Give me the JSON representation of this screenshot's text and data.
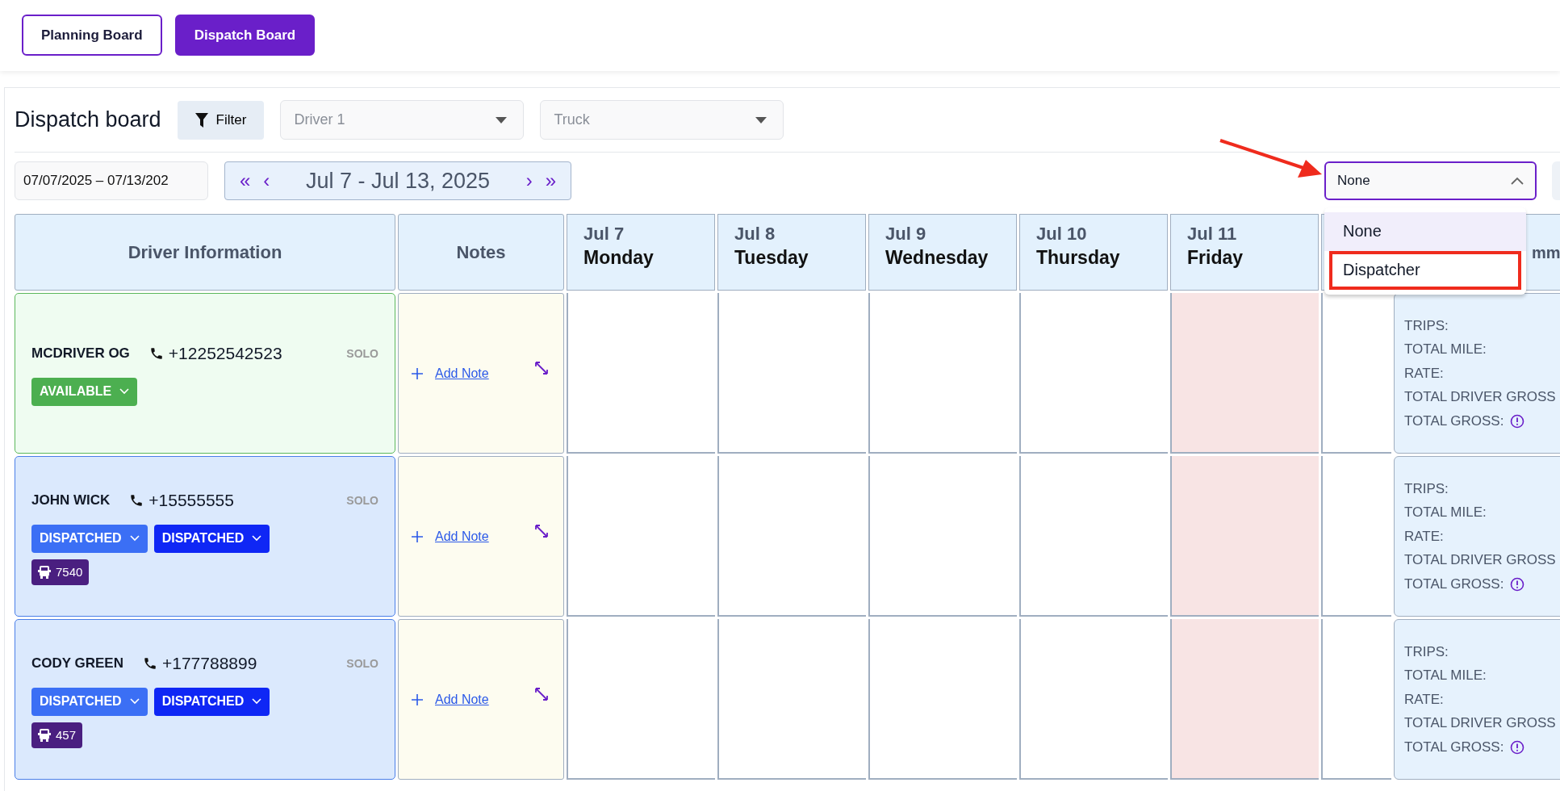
{
  "top_tabs": [
    {
      "label": "Planning Board",
      "selected": false
    },
    {
      "label": "Dispatch Board",
      "selected": true
    }
  ],
  "title": "Dispatch board",
  "filter_button": "Filter",
  "driver_select": {
    "placeholder": "Driver 1"
  },
  "truck_select": {
    "placeholder": "Truck"
  },
  "date_range": "07/07/2025 – 07/13/202",
  "week_nav": {
    "first": "«",
    "prev": "‹",
    "label": "Jul 7 - Jul 13, 2025",
    "next": "›",
    "last": "»"
  },
  "role_select": {
    "value": "None",
    "expanded": true,
    "options": [
      {
        "label": "None",
        "selected": true,
        "highlighted": false
      },
      {
        "label": "Dispatcher",
        "selected": false,
        "highlighted": true
      }
    ]
  },
  "annotation": {
    "arrow": true
  },
  "columns": {
    "driver": "Driver Information",
    "notes": "Notes",
    "summary": "mm"
  },
  "days": [
    {
      "date": "Jul 7",
      "weekday": "Monday",
      "highlight": false
    },
    {
      "date": "Jul 8",
      "weekday": "Tuesday",
      "highlight": false
    },
    {
      "date": "Jul 9",
      "weekday": "Wednesday",
      "highlight": false
    },
    {
      "date": "Jul 10",
      "weekday": "Thursday",
      "highlight": false
    },
    {
      "date": "Jul 11",
      "weekday": "Friday",
      "highlight": true
    }
  ],
  "drivers": [
    {
      "kind": "available",
      "name": "MCDRIVER OG",
      "phone": "+12252542523",
      "team": "SOLO",
      "statuses": [
        {
          "label": "AVAILABLE",
          "color": "#4caf50"
        }
      ],
      "note_link": "Add Note",
      "summary": [
        "TRIPS:",
        "TOTAL MILE:",
        "RATE:",
        "TOTAL DRIVER GROSS",
        "TOTAL GROSS:"
      ]
    },
    {
      "kind": "dispatched",
      "name": "JOHN WICK",
      "phone": "+15555555",
      "team": "SOLO",
      "statuses": [
        {
          "label": "DISPATCHED",
          "color": "#3b6ff5"
        },
        {
          "label": "DISPATCHED",
          "color": "#0f27f5"
        }
      ],
      "truck": "7540",
      "note_link": "Add Note",
      "summary": [
        "TRIPS:",
        "TOTAL MILE:",
        "RATE:",
        "TOTAL DRIVER GROSS",
        "TOTAL GROSS:"
      ]
    },
    {
      "kind": "dispatched",
      "name": "CODY GREEN",
      "phone": "+177788899",
      "team": "SOLO",
      "statuses": [
        {
          "label": "DISPATCHED",
          "color": "#3b6ff5"
        },
        {
          "label": "DISPATCHED",
          "color": "#0f27f5"
        }
      ],
      "truck": "457",
      "note_link": "Add Note",
      "summary": [
        "TRIPS:",
        "TOTAL MILE:",
        "RATE:",
        "TOTAL DRIVER GROSS",
        "TOTAL GROSS:"
      ]
    }
  ]
}
